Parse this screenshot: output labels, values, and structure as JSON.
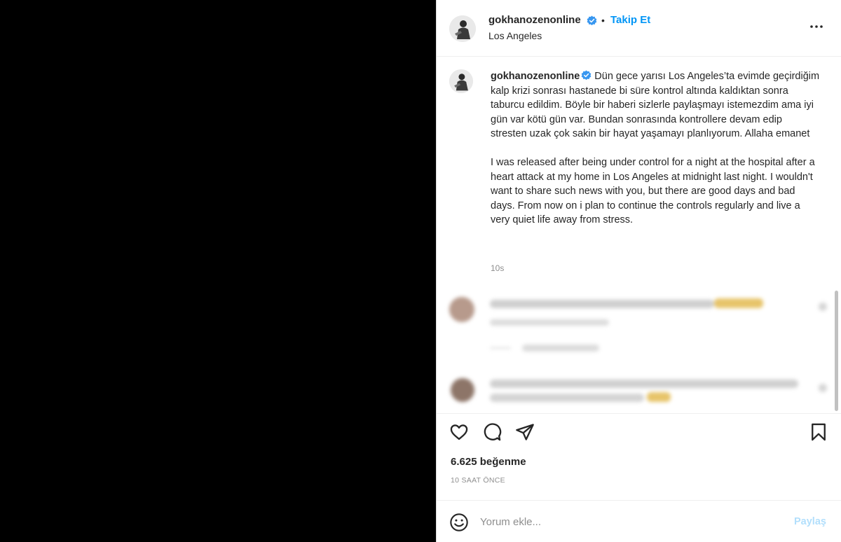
{
  "post": {
    "username": "gokhanozenonline",
    "follow_label": "Takip Et",
    "separator": "•",
    "location": "Los Angeles",
    "caption_tr": "Dün gece yarısı Los Angeles’ta evimde geçirdiğim kalp krizi sonrası hastanede bi süre kontrol altında kaldıktan sonra taburcu edildim. Böyle bir haberi sizlerle paylaşmayı istemezdim ama iyi gün var kötü gün var. Bundan sonrasında kontrollere devam edip stresten uzak çok sakin bir hayat yaşamayı planlıyorum. Allaha emanet",
    "caption_en": "I was released after being under control for a night at the hospital after a heart attack at my home in Los Angeles at midnight last night. I wouldn't want to share such news with you, but there are good days and bad days. From now on i plan to continue the controls regularly and live a very quiet life away from stress.",
    "caption_time": "10s",
    "likes": "6.625 beğenme",
    "post_time": "10 SAAT ÖNCE"
  },
  "comment_box": {
    "placeholder": "Yorum ekle...",
    "share_label": "Paylaş"
  },
  "icons": {
    "more": "more-options-icon",
    "like": "heart-icon",
    "comment": "comment-icon",
    "share": "send-icon",
    "save": "bookmark-icon",
    "emoji": "emoji-icon",
    "verified": "verified-badge-icon"
  },
  "colors": {
    "accent": "#0095f6",
    "verified": "#3897f0",
    "share_disabled": "#b2dffc",
    "muted": "#8e8e8e"
  }
}
